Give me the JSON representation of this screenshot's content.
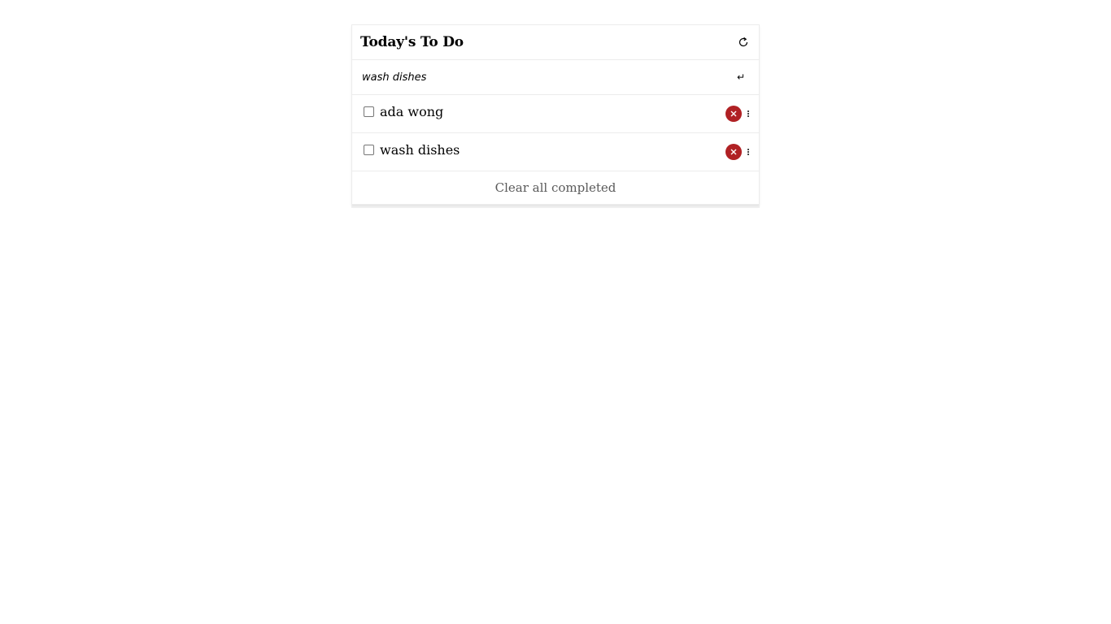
{
  "header": {
    "title": "Today's To Do",
    "reset_icon": "refresh-icon"
  },
  "new_task": {
    "value": "wash dishes",
    "enter_icon": "return-icon",
    "enter_glyph": "↵"
  },
  "todos": [
    {
      "text": "ada wong",
      "checked": false
    },
    {
      "text": "wash dishes",
      "checked": false
    }
  ],
  "footer": {
    "clear_label": "Clear all completed"
  },
  "colors": {
    "delete": "#b02124",
    "border": "#ececec",
    "muted_text": "#5a5a5a"
  }
}
